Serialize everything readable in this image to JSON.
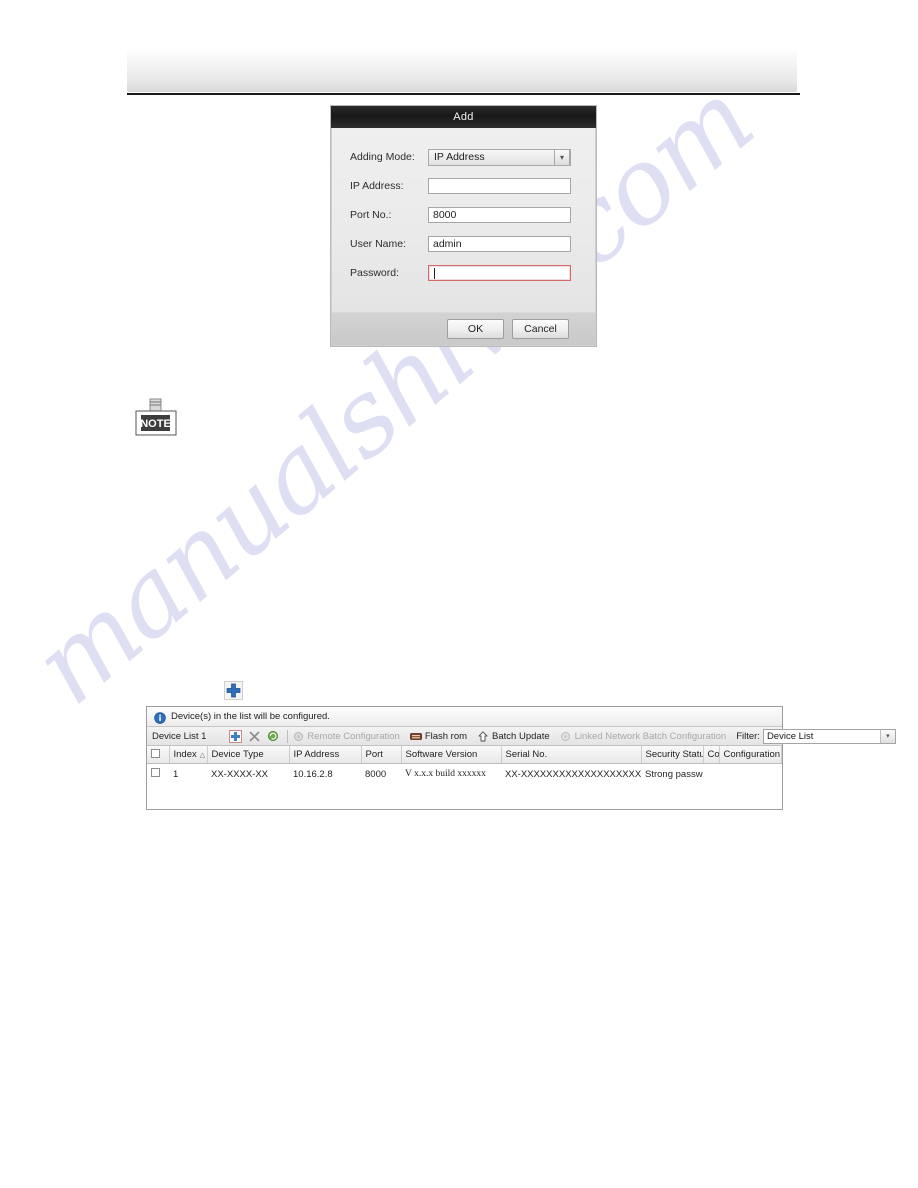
{
  "watermark": {
    "text": "manualshive.com"
  },
  "dialog": {
    "title": "Add",
    "fields": {
      "adding_mode_label": "Adding Mode:",
      "adding_mode_value": "IP Address",
      "ip_address_label": "IP Address:",
      "ip_address_value": "",
      "port_label": "Port No.:",
      "port_value": "8000",
      "user_name_label": "User Name:",
      "user_name_value": "admin",
      "password_label": "Password:",
      "password_value": ""
    },
    "buttons": {
      "ok": "OK",
      "cancel": "Cancel"
    }
  },
  "note": {
    "label": "NOTE"
  },
  "device_panel": {
    "info_message": "Device(s) in the list will be configured.",
    "toolbar": {
      "device_list_label": "Device List 1",
      "add_icon": "plus-icon",
      "delete_icon": "close-icon",
      "refresh_icon": "refresh-icon",
      "actions": [
        {
          "label": "Remote Configuration",
          "icon": "remote-config-icon",
          "disabled": true
        },
        {
          "label": "Flash rom",
          "icon": "flash-rom-icon",
          "disabled": false
        },
        {
          "label": "Batch Update",
          "icon": "batch-update-icon",
          "disabled": false
        },
        {
          "label": "Linked Network Batch Configuration",
          "icon": "linked-network-icon",
          "disabled": true
        }
      ],
      "filter_label": "Filter:",
      "filter_value": "Device List"
    },
    "table": {
      "columns": [
        "Index",
        "Device Type",
        "IP Address",
        "Port",
        "Software Version",
        "Serial No.",
        "Security Status",
        "Configuration Status",
        "Configuration"
      ],
      "rows": [
        {
          "index": "1",
          "device_type": "XX-XXXX-XX",
          "ip_address": "10.16.2.8",
          "port": "8000",
          "software_version": "V x.x.x build xxxxxx",
          "serial_no": "XX-XXXXXXXXXXXXXXXXXXXX",
          "security_status": "Strong password",
          "configuration_status": "",
          "configuration": ""
        }
      ]
    }
  },
  "colors": {
    "accent_blue": "#2f6fba",
    "error_red": "#d46a6a",
    "watermark": "#ccccee"
  }
}
